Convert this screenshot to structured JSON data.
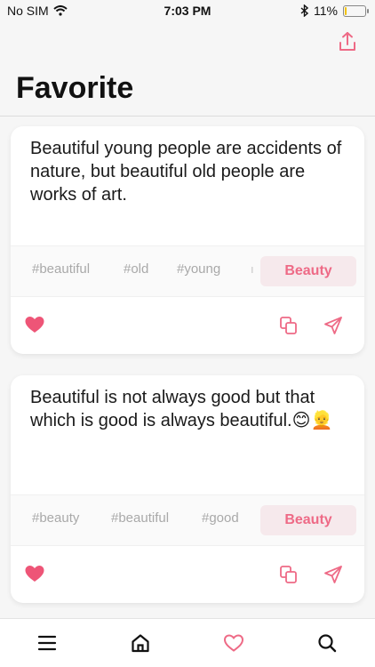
{
  "status": {
    "carrier": "No SIM",
    "time": "7:03 PM",
    "battery_percent": "11%",
    "battery_level": 0.11,
    "battery_color": "#f2c200"
  },
  "header": {
    "title": "Favorite",
    "share_icon": "share-upload-icon"
  },
  "colors": {
    "accent": "#ee6a86",
    "tag_text": "#a9a9a9",
    "category_bg": "#f6e9ec"
  },
  "quotes": [
    {
      "text": "Beautiful young people are accidents of nature, but beautiful old people are works of art.",
      "tags": [
        "#beautiful",
        "#old",
        "#young"
      ],
      "category": "Beauty",
      "favorited": true
    },
    {
      "text": "Beautiful is not always good but that which is good is always beautiful.😊👱",
      "tags": [
        "#beauty",
        "#beautiful",
        "#good"
      ],
      "category": "Beauty",
      "favorited": true
    }
  ],
  "nav": {
    "items": [
      "menu-icon",
      "home-icon",
      "heart-icon",
      "search-icon"
    ],
    "active": "heart-icon"
  }
}
